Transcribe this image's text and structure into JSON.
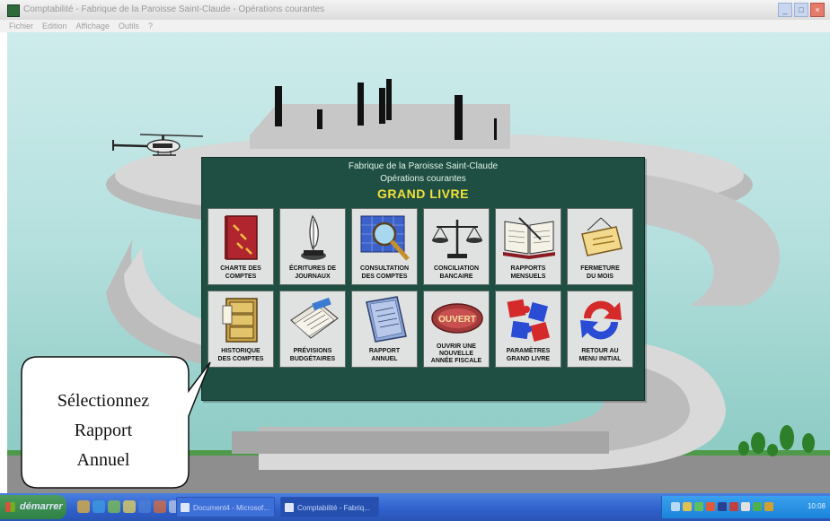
{
  "window": {
    "title": "Comptabilité - Fabrique de la Paroisse Saint-Claude - Opérations courantes",
    "buttons": [
      "_",
      "□",
      "×"
    ]
  },
  "menubar": [
    "Fichier",
    "Edition",
    "Affichage",
    "Outils",
    "?"
  ],
  "panel": {
    "organization": "Fabrique de la Paroisse Saint-Claude",
    "subtitle": "Opérations courantes",
    "heading": "GRAND LIVRE",
    "tiles": [
      {
        "label1": "CHARTE DES",
        "label2": "COMPTES",
        "icon": "ledger-book-icon"
      },
      {
        "label1": "ÉCRITURES DE",
        "label2": "JOURNAUX",
        "icon": "quill-pen-icon"
      },
      {
        "label1": "CONSULTATION",
        "label2": "DES COMPTES",
        "icon": "magnifier-icon"
      },
      {
        "label1": "CONCILIATION",
        "label2": "BANCAIRE",
        "icon": "balance-scale-icon"
      },
      {
        "label1": "RAPPORTS",
        "label2": "MENSUELS",
        "icon": "open-book-icon"
      },
      {
        "label1": "FERMETURE",
        "label2": "DU MOIS",
        "icon": "closed-sign-icon"
      },
      {
        "label1": "HISTORIQUE",
        "label2": "DES COMPTES",
        "icon": "file-cabinet-icon"
      },
      {
        "label1": "PRÉVISIONS",
        "label2": "BUDGÉTAIRES",
        "icon": "budget-papers-icon"
      },
      {
        "label1": "RAPPORT",
        "label2": "ANNUEL",
        "icon": "annual-report-icon"
      },
      {
        "label1": "OUVRIR UNE",
        "label2": "NOUVELLE",
        "label3": "ANNÉE FISCALE",
        "icon": "open-sign-icon",
        "sign_text": "OUVERT"
      },
      {
        "label1": "PARAMÈTRES",
        "label2": "GRAND LIVRE",
        "icon": "puzzle-icon"
      },
      {
        "label1": "RETOUR AU",
        "label2": "MENU INITIAL",
        "icon": "return-arrows-icon"
      }
    ],
    "colors": {
      "panel": "#1e4f42",
      "heading": "#f4e13a",
      "text": "#e4f3ea"
    }
  },
  "callout": {
    "lines": [
      "Sélectionnez",
      "Rapport",
      "Annuel"
    ]
  },
  "taskbar": {
    "start_label": "démarrer",
    "tasks": [
      "Document4 - Microsof...",
      "Comptabilité - Fabriq..."
    ],
    "clock": "10:08"
  }
}
